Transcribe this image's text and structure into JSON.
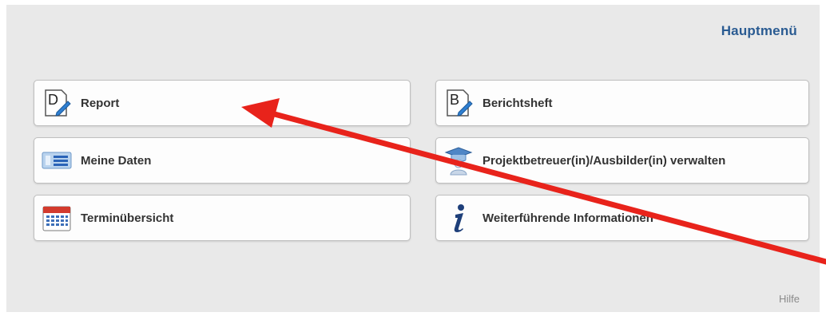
{
  "header": {
    "title": "Hauptmenü"
  },
  "menu": {
    "left": [
      {
        "label": "Report",
        "icon": "report-d-icon"
      },
      {
        "label": "Meine Daten",
        "icon": "my-data-icon"
      },
      {
        "label": "Terminübersicht",
        "icon": "calendar-icon"
      }
    ],
    "right": [
      {
        "label": "Berichtsheft",
        "icon": "report-b-icon"
      },
      {
        "label": "Projektbetreuer(in)/Ausbilder(in) verwalten",
        "icon": "graduate-icon"
      },
      {
        "label": "Weiterführende Informationen",
        "icon": "info-icon"
      }
    ]
  },
  "footer": {
    "help_label": "Hilfe"
  },
  "annotation": {
    "arrow_color": "#e8231b"
  },
  "colors": {
    "title": "#2a5b92",
    "panel": "#e9e9e9"
  }
}
